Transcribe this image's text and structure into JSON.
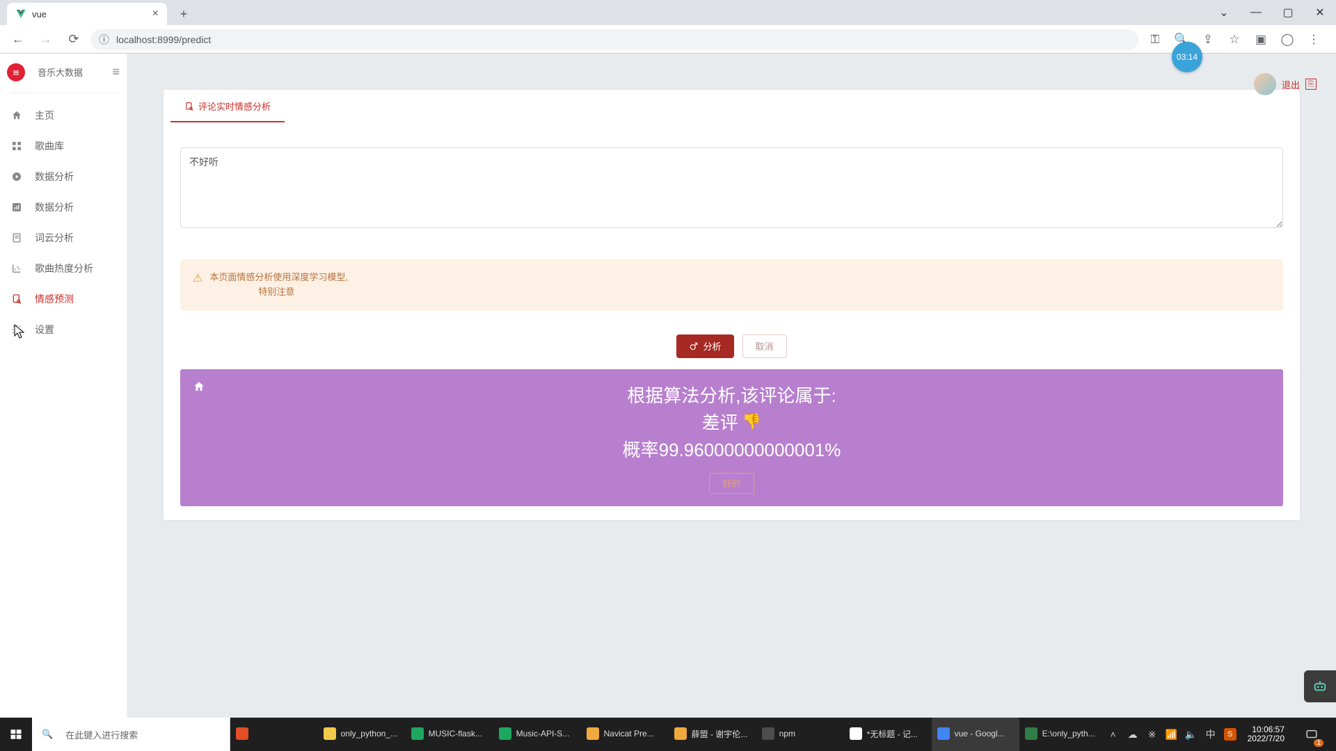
{
  "browser": {
    "tab_title": "vue",
    "url": "localhost:8999/predict"
  },
  "sidebar": {
    "title": "音乐大数据",
    "items": [
      {
        "label": "主页"
      },
      {
        "label": "歌曲库"
      },
      {
        "label": "数据分析"
      },
      {
        "label": "数据分析"
      },
      {
        "label": "词云分析"
      },
      {
        "label": "歌曲热度分析"
      },
      {
        "label": "情感预测"
      },
      {
        "label": "设置"
      }
    ]
  },
  "header": {
    "logout": "退出"
  },
  "card": {
    "tab_label": "评论实时情感分析",
    "textarea_value": "不好听"
  },
  "alert": {
    "line1": "本页面情感分析使用深度学习模型,",
    "line2": "特别注意"
  },
  "buttons": {
    "analyze": "分析",
    "cancel": "取消",
    "ok": "好的"
  },
  "result": {
    "heading": "根据算法分析,该评论属于:",
    "sentiment": "差评",
    "probability_label": "概率",
    "probability_value": "99.96000000000001%"
  },
  "badge": {
    "time": "03:14"
  },
  "taskbar": {
    "search_placeholder": "在此键入进行搜索",
    "apps": [
      {
        "label": "",
        "color": "#e44d26"
      },
      {
        "label": "only_python_...",
        "color": "#f3c94a"
      },
      {
        "label": "MUSIC-flask...",
        "color": "#1ea85f"
      },
      {
        "label": "Music-API-S...",
        "color": "#1ea85f"
      },
      {
        "label": "Navicat Pre...",
        "color": "#f0a93c"
      },
      {
        "label": "薛盟 - 谢宇伦...",
        "color": "#f0a93c"
      },
      {
        "label": "npm",
        "color": "#4d4d4d"
      },
      {
        "label": "*无标题 - 记...",
        "color": "#ffffff"
      },
      {
        "label": "vue - Googl...",
        "color": "#4285f4"
      },
      {
        "label": "E:\\only_pyth...",
        "color": "#2f7d46"
      }
    ],
    "time": "10:06:57",
    "date": "2022/7/20",
    "notif_count": "1"
  }
}
